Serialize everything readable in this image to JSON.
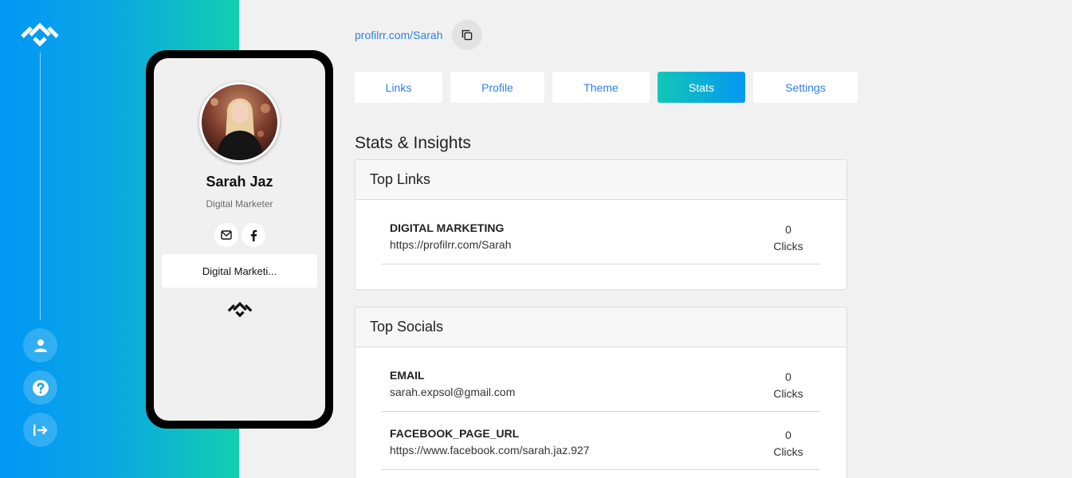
{
  "rail": {
    "logo": "diamond-logo-icon",
    "buttons": [
      {
        "name": "user-icon"
      },
      {
        "name": "help-icon"
      },
      {
        "name": "logout-icon"
      }
    ]
  },
  "preview": {
    "name": "Sarah Jaz",
    "title": "Digital Marketer",
    "socials": [
      "email-icon",
      "facebook-icon"
    ],
    "link_label": "Digital Marketi..."
  },
  "header": {
    "url": "profilrr.com/Sarah"
  },
  "tabs": [
    {
      "label": "Links"
    },
    {
      "label": "Profile"
    },
    {
      "label": "Theme"
    },
    {
      "label": "Stats",
      "active": true
    },
    {
      "label": "Settings"
    }
  ],
  "stats": {
    "title": "Stats & Insights",
    "top_links": {
      "heading": "Top Links",
      "rows": [
        {
          "title": "DIGITAL MARKETING",
          "sub": "https://profilrr.com/Sarah",
          "count": "0",
          "unit": "Clicks"
        }
      ]
    },
    "top_socials": {
      "heading": "Top Socials",
      "rows": [
        {
          "title": "EMAIL",
          "sub": "sarah.expsol@gmail.com",
          "count": "0",
          "unit": "Clicks"
        },
        {
          "title": "FACEBOOK_PAGE_URL",
          "sub": "https://www.facebook.com/sarah.jaz.927",
          "count": "0",
          "unit": "Clicks"
        }
      ]
    }
  },
  "colors": {
    "accent": "#2f7fe6",
    "gradient_start": "#0197f6",
    "gradient_end": "#12cfb0"
  }
}
